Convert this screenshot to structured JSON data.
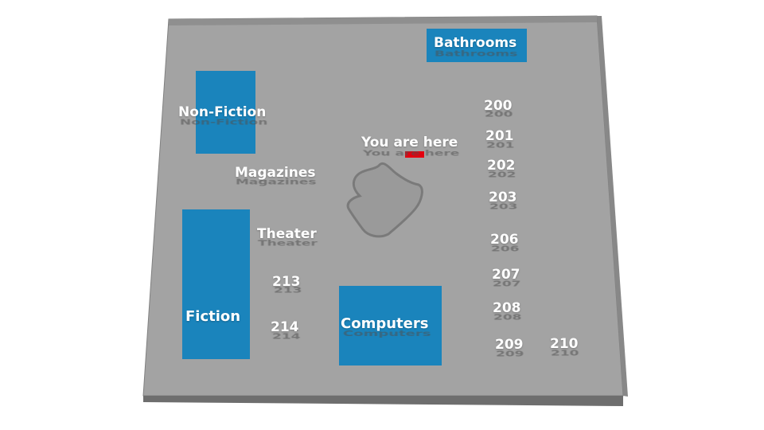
{
  "map": {
    "colors": {
      "floor": "#a3a3a3",
      "floor_edge": "#7d7d7d",
      "section_block": "#1a84bc",
      "label": "#ffffff",
      "marker": "#e3000f"
    },
    "you_are_here": "You are here",
    "sections": {
      "bathrooms": "Bathrooms",
      "non_fiction": "Non-Fiction",
      "magazines": "Magazines",
      "theater": "Theater",
      "fiction": "Fiction",
      "computers": "Computers"
    },
    "rooms": {
      "r200": "200",
      "r201": "201",
      "r202": "202",
      "r203": "203",
      "r206": "206",
      "r207": "207",
      "r208": "208",
      "r209": "209",
      "r210": "210",
      "r213": "213",
      "r214": "214"
    }
  }
}
